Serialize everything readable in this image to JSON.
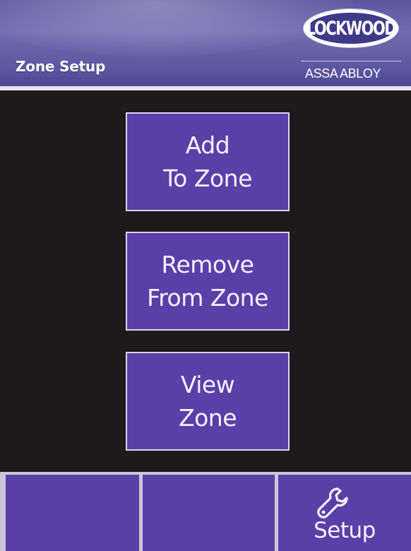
{
  "header": {
    "title": "Zone Setup",
    "logo_text": "LOCKWOOD",
    "logo_sub": "ASSA ABLOY"
  },
  "menu": {
    "add": {
      "line1": "Add",
      "line2": "To Zone"
    },
    "remove": {
      "line1": "Remove",
      "line2": "From Zone"
    },
    "view": {
      "line1": "View",
      "line2": "Zone"
    }
  },
  "bottom_bar": {
    "setup_label": "Setup",
    "setup_icon": "wrench-icon"
  },
  "colors": {
    "header": "#5e5aa3",
    "button": "#5a3fa8",
    "background": "#1c1a1a",
    "button_border": "#d9d6ea"
  }
}
